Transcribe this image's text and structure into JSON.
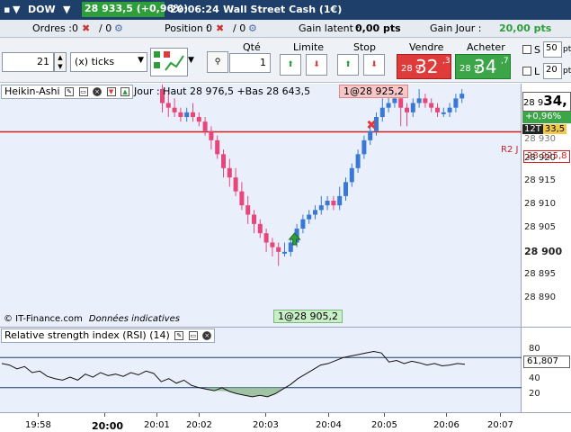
{
  "titlebar": {
    "instrument": "DOW",
    "price_change": "28 933,5 (+0,96%)",
    "time": "20:06:24",
    "name": "Wall Street Cash (1€)"
  },
  "infobar": {
    "orders_label": "Ordres :",
    "orders_value": "0",
    "orders_sep": "/ 0",
    "position_label": "Position :",
    "position_value": "0",
    "position_sep": "/ 0",
    "gain_latent_label": "Gain latent :",
    "gain_latent_value": "0,00 pts",
    "gain_jour_label": "Gain Jour :",
    "gain_jour_value": "20,00 pts"
  },
  "toolbar": {
    "qty_ticks": "21",
    "ticks_unit": "(x) ticks",
    "qte_label": "Qté",
    "qte_value": "1",
    "limite_label": "Limite",
    "stop_label": "Stop",
    "vendre_label": "Vendre",
    "acheter_label": "Acheter",
    "sell_prefix": "28 9",
    "sell_big": "32",
    "sell_small": ",3",
    "buy_prefix": "28 9",
    "buy_big": "34",
    "buy_small": ",7",
    "s_label": "S",
    "s_value": "50",
    "l_label": "L",
    "l_value": "20",
    "unit_pt": "pt",
    "unit_pts": "pts"
  },
  "chart": {
    "header_label": "Heikin-Ashi",
    "info_text": "Jour : Haut 28 976,5 +Bas 28 643,5",
    "top_tag": "1@28 925,2",
    "bottom_tag": "1@28 905,2",
    "r2_label": "R2 J",
    "r2_value": "28 925,8",
    "copyright": "© IT-Finance.com",
    "data_note": "Données indicatives",
    "last_price_prefix": "28 9",
    "last_price_big": "34,",
    "pct_change": "+0,96%",
    "timer": "12T",
    "timer_value": "33,5",
    "partial_tick": "28 930",
    "yticks": [
      "28 920",
      "28 915",
      "28 910",
      "28 905",
      "28 900",
      "28 895",
      "28 890"
    ],
    "colors": {
      "up": "#3a78d8",
      "down": "#e8457a",
      "r2": "#cc2222",
      "bg": "#e9effb"
    }
  },
  "chart_data": {
    "type": "candlestick",
    "ylim": [
      28887,
      28935
    ],
    "reference_line": 28925.8,
    "trades": [
      {
        "side": "sell",
        "price": 28925.2,
        "marker": "red-x"
      },
      {
        "side": "buy",
        "price": 28905.2,
        "marker": "green-up-arrow"
      }
    ],
    "candles": [
      {
        "o": 28935,
        "c": 28932,
        "h": 28936,
        "l": 28930
      },
      {
        "o": 28932,
        "c": 28931,
        "h": 28934,
        "l": 28929
      },
      {
        "o": 28931,
        "c": 28930,
        "h": 28933,
        "l": 28929
      },
      {
        "o": 28930,
        "c": 28929,
        "h": 28931,
        "l": 28928
      },
      {
        "o": 28929,
        "c": 28930,
        "h": 28931,
        "l": 28928
      },
      {
        "o": 28930,
        "c": 28929,
        "h": 28932,
        "l": 28928
      },
      {
        "o": 28929,
        "c": 28928,
        "h": 28930,
        "l": 28927
      },
      {
        "o": 28928,
        "c": 28926,
        "h": 28929,
        "l": 28925
      },
      {
        "o": 28926,
        "c": 28924,
        "h": 28927,
        "l": 28922
      },
      {
        "o": 28924,
        "c": 28921,
        "h": 28925,
        "l": 28920
      },
      {
        "o": 28921,
        "c": 28918,
        "h": 28922,
        "l": 28916
      },
      {
        "o": 28918,
        "c": 28916,
        "h": 28920,
        "l": 28914
      },
      {
        "o": 28916,
        "c": 28913,
        "h": 28918,
        "l": 28912
      },
      {
        "o": 28913,
        "c": 28910,
        "h": 28915,
        "l": 28909
      },
      {
        "o": 28910,
        "c": 28908,
        "h": 28912,
        "l": 28906
      },
      {
        "o": 28908,
        "c": 28906,
        "h": 28909,
        "l": 28904
      },
      {
        "o": 28906,
        "c": 28904,
        "h": 28907,
        "l": 28903
      },
      {
        "o": 28904,
        "c": 28902,
        "h": 28905,
        "l": 28900
      },
      {
        "o": 28902,
        "c": 28901,
        "h": 28903,
        "l": 28899
      },
      {
        "o": 28901,
        "c": 28900,
        "h": 28902,
        "l": 28897
      },
      {
        "o": 28900,
        "c": 28900,
        "h": 28902,
        "l": 28899
      },
      {
        "o": 28900,
        "c": 28902,
        "h": 28903,
        "l": 28899
      },
      {
        "o": 28902,
        "c": 28905,
        "h": 28906,
        "l": 28901
      },
      {
        "o": 28905,
        "c": 28907,
        "h": 28908,
        "l": 28904
      },
      {
        "o": 28907,
        "c": 28908,
        "h": 28909,
        "l": 28906
      },
      {
        "o": 28908,
        "c": 28909,
        "h": 28910,
        "l": 28907
      },
      {
        "o": 28909,
        "c": 28910,
        "h": 28912,
        "l": 28908
      },
      {
        "o": 28910,
        "c": 28911,
        "h": 28912,
        "l": 28909
      },
      {
        "o": 28911,
        "c": 28910,
        "h": 28912,
        "l": 28909
      },
      {
        "o": 28910,
        "c": 28912,
        "h": 28914,
        "l": 28909
      },
      {
        "o": 28912,
        "c": 28915,
        "h": 28916,
        "l": 28911
      },
      {
        "o": 28915,
        "c": 28918,
        "h": 28919,
        "l": 28914
      },
      {
        "o": 28918,
        "c": 28921,
        "h": 28922,
        "l": 28917
      },
      {
        "o": 28921,
        "c": 28924,
        "h": 28925,
        "l": 28920
      },
      {
        "o": 28924,
        "c": 28926,
        "h": 28928,
        "l": 28923
      },
      {
        "o": 28926,
        "c": 28929,
        "h": 28930,
        "l": 28925
      },
      {
        "o": 28929,
        "c": 28931,
        "h": 28933,
        "l": 28928
      },
      {
        "o": 28931,
        "c": 28932,
        "h": 28934,
        "l": 28930
      },
      {
        "o": 28932,
        "c": 28933,
        "h": 28934,
        "l": 28931
      },
      {
        "o": 28933,
        "c": 28931,
        "h": 28934,
        "l": 28927
      },
      {
        "o": 28931,
        "c": 28930,
        "h": 28932,
        "l": 28927
      },
      {
        "o": 28930,
        "c": 28932,
        "h": 28933,
        "l": 28929
      },
      {
        "o": 28932,
        "c": 28933,
        "h": 28935,
        "l": 28931
      },
      {
        "o": 28933,
        "c": 28932,
        "h": 28934,
        "l": 28931
      },
      {
        "o": 28932,
        "c": 28931,
        "h": 28933,
        "l": 28930
      },
      {
        "o": 28931,
        "c": 28930,
        "h": 28932,
        "l": 28929
      },
      {
        "o": 28930,
        "c": 28930,
        "h": 28931,
        "l": 28929
      },
      {
        "o": 28930,
        "c": 28931,
        "h": 28932,
        "l": 28929
      },
      {
        "o": 28931,
        "c": 28933,
        "h": 28934,
        "l": 28930
      },
      {
        "o": 28933,
        "c": 28934,
        "h": 28935,
        "l": 28932
      }
    ]
  },
  "rsi": {
    "label": "Relative strength index (RSI) (14)",
    "value": "61,807",
    "yticks": [
      "80",
      "60",
      "40",
      "20"
    ],
    "levels": [
      70,
      30
    ],
    "values": [
      62,
      60,
      55,
      58,
      50,
      52,
      45,
      42,
      40,
      44,
      40,
      48,
      44,
      50,
      46,
      48,
      45,
      50,
      47,
      52,
      49,
      38,
      42,
      36,
      40,
      33,
      30,
      28,
      26,
      30,
      25,
      22,
      20,
      18,
      20,
      18,
      22,
      28,
      34,
      42,
      48,
      54,
      60,
      62,
      66,
      70,
      72,
      74,
      76,
      78,
      76,
      64,
      66,
      62,
      65,
      63,
      60,
      62,
      59,
      60,
      62,
      61
    ]
  },
  "timeaxis": {
    "labels": [
      "19:58",
      "20:00",
      "20:01",
      "20:02",
      "20:03",
      "20:04",
      "20:05",
      "20:06",
      "20:07"
    ]
  }
}
